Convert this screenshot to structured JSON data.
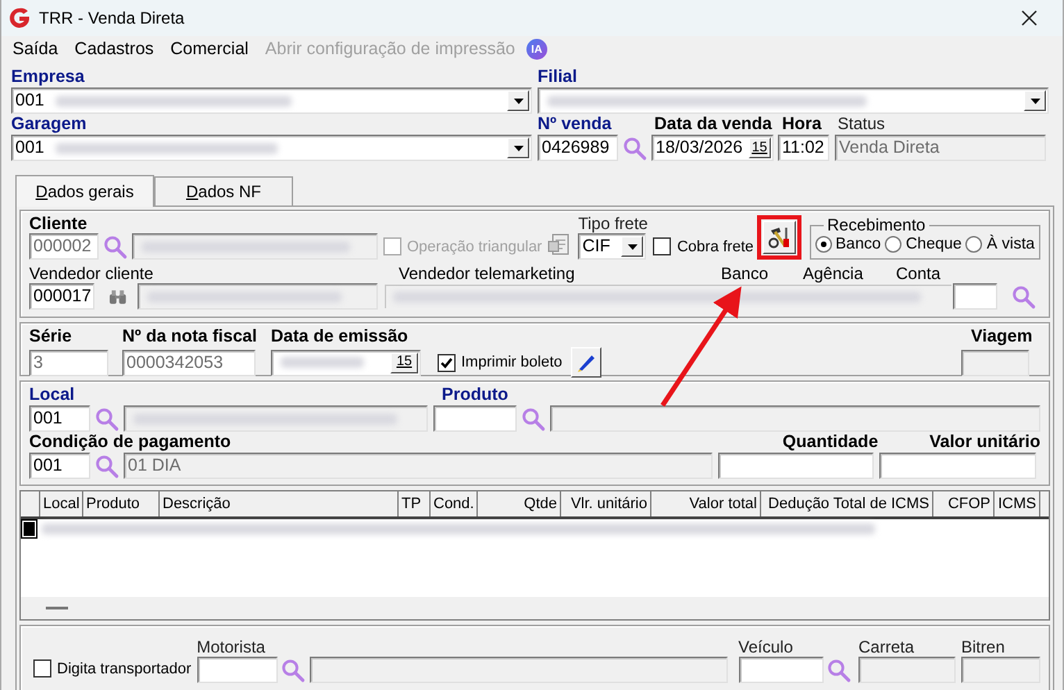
{
  "window": {
    "title": "TRR - Venda Direta"
  },
  "menu": [
    {
      "label": "Saída",
      "disabled": false
    },
    {
      "label": "Cadastros",
      "disabled": false
    },
    {
      "label": "Comercial",
      "disabled": false
    },
    {
      "label": "Abrir configuração de impressão",
      "disabled": true
    }
  ],
  "ia_badge": "IA",
  "header": {
    "empresa": {
      "label": "Empresa",
      "value": "001"
    },
    "filial": {
      "label": "Filial"
    },
    "garagem": {
      "label": "Garagem",
      "value": "001"
    },
    "numero_venda": {
      "label": "Nº venda",
      "value": "0426989"
    },
    "data_venda": {
      "label": "Data da venda",
      "value": "18/03/2026",
      "calendar": "15"
    },
    "hora": {
      "label": "Hora",
      "value": "11:02"
    },
    "status": {
      "label": "Status",
      "value": "Venda Direta"
    }
  },
  "tabs": [
    {
      "label": "Dados gerais",
      "selected": true
    },
    {
      "label": "Dados NF",
      "selected": false
    }
  ],
  "cliente": {
    "label": "Cliente",
    "value": "000002",
    "operacao_triangular": {
      "label": "Operação triangular",
      "checked": false,
      "disabled": true
    },
    "tipo_frete": {
      "label": "Tipo frete",
      "value": "CIF"
    },
    "cobra_frete": {
      "label": "Cobra frete",
      "checked": false
    }
  },
  "recebimento": {
    "label": "Recebimento",
    "options": [
      {
        "label": "Banco",
        "selected": true
      },
      {
        "label": "Cheque",
        "selected": false
      },
      {
        "label": "À vista",
        "selected": false
      }
    ]
  },
  "vendedores": {
    "vendedor_cliente": {
      "label": "Vendedor cliente",
      "value": "000017"
    },
    "vendedor_telemarketing": {
      "label": "Vendedor telemarketing"
    },
    "banco": {
      "label": "Banco"
    },
    "agencia": {
      "label": "Agência"
    },
    "conta": {
      "label": "Conta"
    }
  },
  "nota": {
    "serie": {
      "label": "Série",
      "value": "3"
    },
    "numero": {
      "label": "Nº da nota fiscal",
      "value": "0000342053"
    },
    "data_emissao": {
      "label": "Data de emissão",
      "calendar": "15"
    },
    "imprimir_boleto": {
      "label": "Imprimir boleto",
      "checked": true
    },
    "viagem": {
      "label": "Viagem"
    }
  },
  "item": {
    "local": {
      "label": "Local",
      "value": "001"
    },
    "produto": {
      "label": "Produto"
    },
    "condicao": {
      "label": "Condição de pagamento",
      "value": "001",
      "description": "01 DIA"
    },
    "quantidade": {
      "label": "Quantidade"
    },
    "valor_unitario": {
      "label": "Valor unitário"
    }
  },
  "table": {
    "columns": [
      "Local",
      "Produto",
      "Descrição",
      "TP",
      "Cond.",
      "Qtde",
      "Vlr. unitário",
      "Valor total",
      "Dedução Total de ICMS",
      "CFOP",
      "ICMS"
    ]
  },
  "transporte": {
    "digita_transportador": {
      "label": "Digita transportador",
      "checked": false
    },
    "motorista": {
      "label": "Motorista"
    },
    "veiculo": {
      "label": "Veículo"
    },
    "carreta": {
      "label": "Carreta"
    },
    "bitren": {
      "label": "Bitren"
    }
  }
}
